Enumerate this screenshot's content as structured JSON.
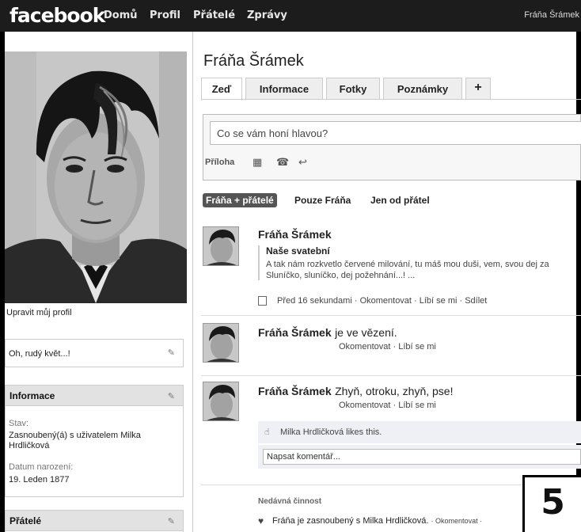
{
  "topbar": {
    "logo": "facebook",
    "nav": [
      "Domů",
      "Profil",
      "Přátelé",
      "Zprávy"
    ],
    "user": "Fráňa Šrámek"
  },
  "profile": {
    "name": "Fráňa Šrámek",
    "tabs": [
      "Zeď",
      "Informace",
      "Fotky",
      "Poznámky",
      "+"
    ],
    "edit_profile": "Upravit můj profil",
    "status_box": "Oh, rudý květ...!",
    "info": {
      "heading": "Informace",
      "stav_label": "Stav:",
      "stav_value": "Zasnoubený(á) s uživatelem Milka Hrdličková",
      "birth_label": "Datum narození:",
      "birth_value": "19. Leden 1877"
    },
    "friends_heading": "Přátelé"
  },
  "composer": {
    "placeholder": "Co se vám honí hlavou?",
    "attach_label": "Příloha"
  },
  "filters": [
    "Fráňa + přátelé",
    "Pouze Fráňa",
    "Jen od přátel"
  ],
  "posts": [
    {
      "author": "Fráňa Šrámek",
      "note_title": "Naše svatební",
      "note_text_1": "A tak nám rozkvetlo červené milování, tu máš mou duši, vem, svou dej za",
      "note_text_2": "Sluníčko, sluníčko, dej požehnání...! ...",
      "time": "Před 16 sekundami",
      "actions": "· Okomentovat · Líbí se mi · Sdílet"
    },
    {
      "author": "Fráňa Šrámek",
      "text": "je ve vězení.",
      "actions": "Okomentovat · Líbí se mi"
    },
    {
      "author": "Fráňa Šrámek",
      "text": "Zhyň, otroku, zhyň, pse!",
      "actions": "Okomentovat · Líbí se mi",
      "likes": "Milka Hrdličková likes this.",
      "comment_placeholder": "Napsat komentář..."
    }
  ],
  "recent": {
    "heading": "Nedávná činnost",
    "item": "Fráňa je zasnoubený s Milka Hrdličková.",
    "item_action": "· Okomentovat ·"
  },
  "badge": "5"
}
